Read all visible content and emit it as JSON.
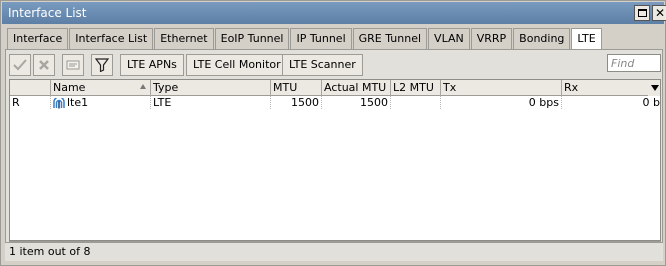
{
  "window": {
    "title": "Interface List"
  },
  "tabs": [
    {
      "label": "Interface"
    },
    {
      "label": "Interface List"
    },
    {
      "label": "Ethernet"
    },
    {
      "label": "EoIP Tunnel"
    },
    {
      "label": "IP Tunnel"
    },
    {
      "label": "GRE Tunnel"
    },
    {
      "label": "VLAN"
    },
    {
      "label": "VRRP"
    },
    {
      "label": "Bonding"
    },
    {
      "label": "LTE",
      "active": true
    }
  ],
  "toolbar": {
    "icons": [
      "check-icon",
      "cross-icon",
      "comment-icon",
      "filter-icon"
    ],
    "lte_apns": "LTE APNs",
    "lte_cell_monitor": "LTE Cell Monitor",
    "lte_scanner": "LTE Scanner",
    "find_placeholder": "Find"
  },
  "table": {
    "columns": [
      "",
      "Name",
      "Type",
      "MTU",
      "Actual MTU",
      "L2 MTU",
      "Tx",
      "Rx"
    ],
    "sort_column": "Name",
    "rows": [
      {
        "flag": "R",
        "icon": "lte-interface-icon",
        "name": "lte1",
        "type": "LTE",
        "mtu": "1500",
        "actual_mtu": "1500",
        "l2_mtu": "",
        "tx": "0 bps",
        "rx": "0 b"
      }
    ]
  },
  "status": {
    "text": "1 item out of 8"
  },
  "colors": {
    "titlebar": "#6b8db4",
    "window_bg": "#d4d0c8",
    "lte_icon": "#3a7fc4"
  }
}
